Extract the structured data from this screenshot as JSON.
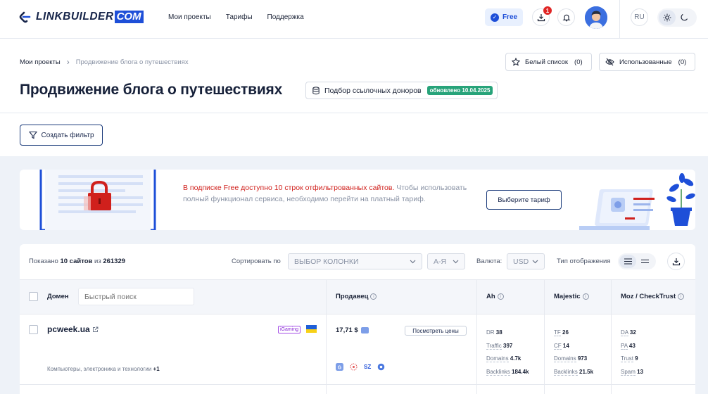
{
  "header": {
    "logo_text": "LINKBUILDER",
    "logo_com": "COM",
    "nav": [
      "Мои проекты",
      "Тарифы",
      "Поддержка"
    ],
    "plan_label": "Free",
    "downloads_badge": "1",
    "language": "RU",
    "icons": [
      "download-icon",
      "bell-icon",
      "sun-icon",
      "moon-icon"
    ]
  },
  "breadcrumb": {
    "root": "Мои проекты",
    "current": "Продвижение блога о путешествиях"
  },
  "lists": {
    "whitelist_label": "Белый список",
    "whitelist_count": "(0)",
    "used_label": "Использованные",
    "used_count": "(0)"
  },
  "page": {
    "title": "Продвижение блога о путешествиях",
    "tool_label": "Подбор ссылочных доноров",
    "updated_badge": "обновлено 10.04.2025",
    "filter_button": "Создать фильтр"
  },
  "promo": {
    "highlight": "В подписке Free доступно 10 строк отфильтрованных сайтов.",
    "text": " Чтобы использовать полный функционал сервиса, необходимо перейти на платный тариф.",
    "button": "Выберите тариф",
    "colors": {
      "highlight": "#d0201c",
      "accent": "#1e4fd8"
    }
  },
  "toolbar": {
    "shown_prefix": "Показано ",
    "shown_count": "10 сайтов",
    "shown_mid": " из ",
    "shown_total": "261329",
    "sort_label": "Сортировать по",
    "sort_value": "ВЫБОР КОЛОНКИ",
    "order_value": "А-Я",
    "currency_label": "Валюта:",
    "currency_value": "USD",
    "view_label": "Тип отображения"
  },
  "table": {
    "columns": {
      "domain": "Домен",
      "search_placeholder": "Быстрый поиск",
      "seller": "Продавец",
      "ah": "Ah",
      "majestic": "Majestic",
      "moz": "Moz / CheckTrust"
    },
    "rows": [
      {
        "domain": "pcweek.ua",
        "tag": "iGaming",
        "category": "Компьютеры, электроника и технологии",
        "category_more": "+1",
        "price": "17,71 $",
        "see_prices": "Посмотреть цены",
        "seller_sz": "SZ",
        "ah": {
          "dr_label": "DR",
          "dr": "38",
          "traffic_label": "Traffic",
          "traffic": "397",
          "domains_label": "Domains",
          "domains": "4.7k",
          "backlinks_label": "Backlinks",
          "backlinks": "184.4k"
        },
        "majestic": {
          "tf_label": "TF",
          "tf": "26",
          "cf_label": "CF",
          "cf": "14",
          "domains_label": "Domains",
          "domains": "973",
          "backlinks_label": "Backlinks",
          "backlinks": "21.5k"
        },
        "moz": {
          "da_label": "DA",
          "da": "32",
          "pa_label": "PA",
          "pa": "43",
          "trust_label": "Trust",
          "trust": "9",
          "spam_label": "Spam",
          "spam": "13"
        }
      }
    ]
  }
}
